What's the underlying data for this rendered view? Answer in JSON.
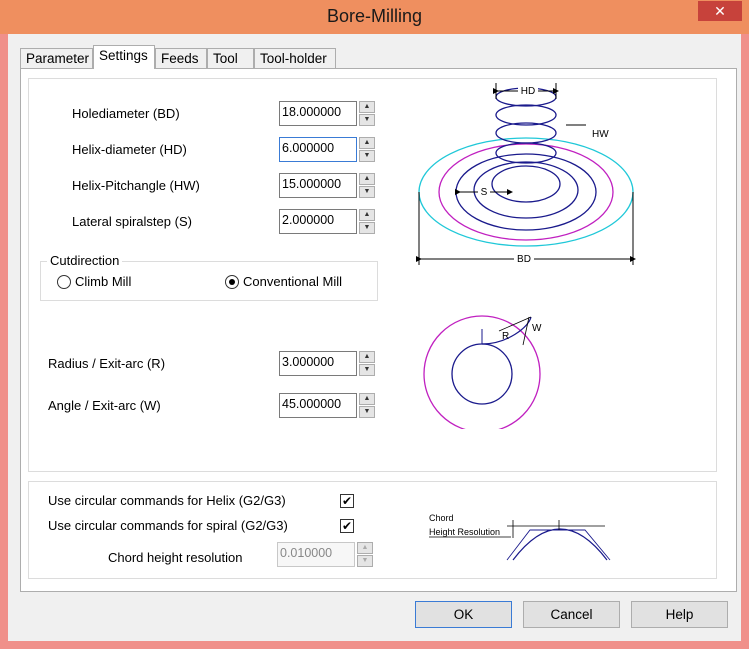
{
  "window": {
    "title": "Bore-Milling",
    "close_symbol": "✕"
  },
  "tabs": [
    {
      "label": "Parameter"
    },
    {
      "label": "Settings"
    },
    {
      "label": "Feeds"
    },
    {
      "label": "Tool"
    },
    {
      "label": "Tool-holder"
    }
  ],
  "settings": {
    "hole_diameter": {
      "label": "Holediameter (BD)",
      "value": "18.000000"
    },
    "helix_diameter": {
      "label": "Helix-diameter (HD)",
      "value": "6.000000"
    },
    "helix_pitch": {
      "label": "Helix-Pitchangle (HW)",
      "value": "15.000000"
    },
    "lateral_step": {
      "label": "Lateral spiralstep (S)",
      "value": "2.000000"
    },
    "cutdirection": {
      "title": "Cutdirection",
      "climb": "Climb Mill",
      "conventional": "Conventional Mill",
      "selected": "conventional"
    },
    "exit_radius": {
      "label": "Radius / Exit-arc (R)",
      "value": "3.000000"
    },
    "exit_angle": {
      "label": "Angle / Exit-arc (W)",
      "value": "45.000000"
    },
    "circular_helix": {
      "label": "Use circular commands for Helix  (G2/G3)",
      "checked": true
    },
    "circular_spiral": {
      "label": "Use circular commands for spiral  (G2/G3)",
      "checked": true
    },
    "chord_resolution": {
      "label": "Chord height resolution",
      "value": "0.010000"
    }
  },
  "diagram_labels": {
    "hd": "HD",
    "hw": "HW",
    "s": "S",
    "bd": "BD",
    "r": "R",
    "w": "W",
    "chord": "Chord",
    "height_resolution": "Height Resolution"
  },
  "buttons": {
    "ok": "OK",
    "cancel": "Cancel",
    "help": "Help"
  },
  "colors": {
    "title_bar": "#ef8f5f",
    "close": "#c7423b",
    "helix": "#1a1a8c",
    "outer_circle": "#20c8d8",
    "spiral": "#c020c0"
  },
  "icons": {
    "spin_up": "▲",
    "spin_down": "▼",
    "check": "✔"
  }
}
